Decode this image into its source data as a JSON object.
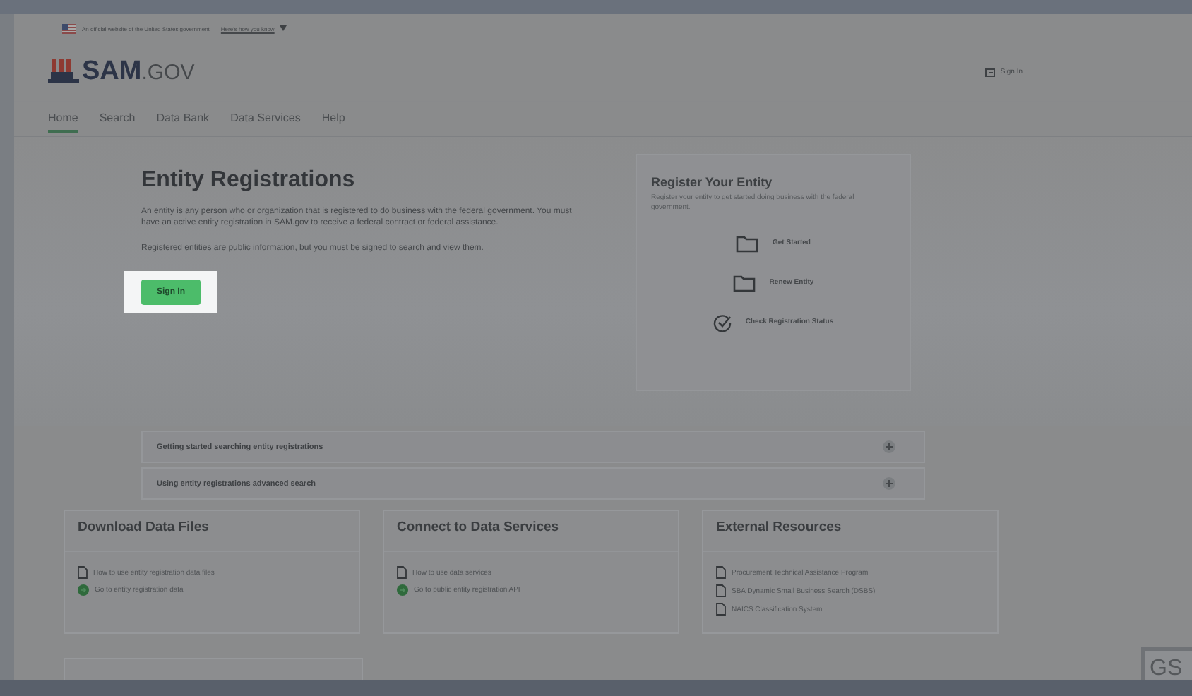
{
  "gov_banner": {
    "text": "An official website of the United States government",
    "link": "Here's how you know"
  },
  "logo": {
    "text": "SAM",
    "suffix": ".GOV"
  },
  "account": {
    "label": "Sign In"
  },
  "nav": [
    {
      "label": "Home",
      "selected": true
    },
    {
      "label": "Search",
      "selected": false
    },
    {
      "label": "Data Bank",
      "selected": false
    },
    {
      "label": "Data Services",
      "selected": false
    },
    {
      "label": "Help",
      "selected": false
    }
  ],
  "hero": {
    "title": "Entity Registrations",
    "paragraphs": [
      "An entity is any person who or organization that is registered to do business with the federal government. You must have an active entity registration in SAM.gov to receive a federal contract or federal assistance.",
      "Registered entities are public information, but you must be signed to search and view them."
    ],
    "button": {
      "label": "Sign In",
      "highlighted": true
    }
  },
  "register_card": {
    "title": "Register Your Entity",
    "description": "Register your entity to get started doing business with the federal government.",
    "actions": [
      {
        "label": "Get Started",
        "kind": "folder"
      },
      {
        "label": "Renew Entity",
        "kind": "folder"
      },
      {
        "label": "Check Registration Status",
        "kind": "check"
      }
    ]
  },
  "accordion": [
    {
      "label": "Getting started searching entity registrations",
      "expanded": false
    },
    {
      "label": "Using entity registrations advanced search",
      "expanded": false
    }
  ],
  "cards": [
    {
      "title": "Download Data Files",
      "links": [
        {
          "label": "How to use entity registration data files",
          "kind": "doc"
        },
        {
          "label": "Go to entity registration data",
          "kind": "go"
        }
      ]
    },
    {
      "title": "Connect to Data Services",
      "links": [
        {
          "label": "How to use data services",
          "kind": "doc"
        },
        {
          "label": "Go to public entity registration API",
          "kind": "go"
        }
      ]
    },
    {
      "title": "External Resources",
      "links": [
        {
          "label": "Procurement Technical Assistance Program",
          "kind": "doc"
        },
        {
          "label": "SBA Dynamic Small Business Search (DSBS)",
          "kind": "doc"
        },
        {
          "label": "NAICS Classification System",
          "kind": "doc"
        }
      ]
    }
  ],
  "corner_logo": {
    "text": "GS"
  }
}
